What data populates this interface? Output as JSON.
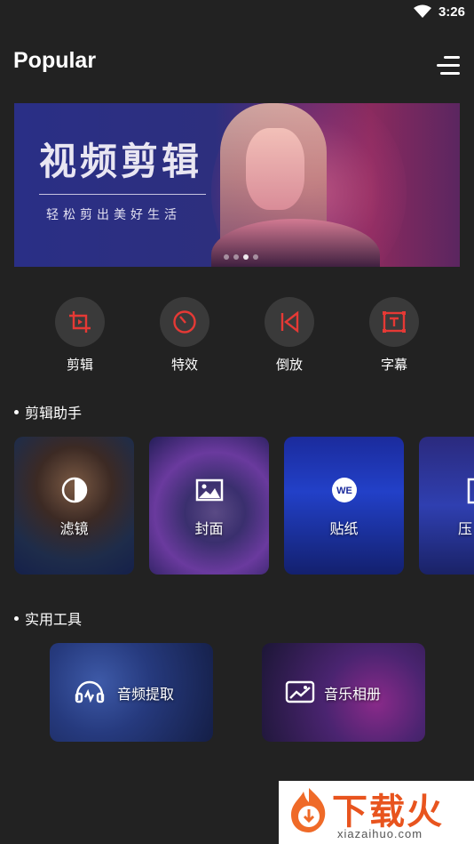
{
  "status_bar": {
    "time": "3:26"
  },
  "header": {
    "title": "Popular"
  },
  "banner": {
    "title": "视频剪辑",
    "subtitle": "轻松剪出美好生活",
    "slide_count": 4,
    "active_slide": 2
  },
  "quick_tools": [
    {
      "label": "剪辑",
      "icon": "crop-icon"
    },
    {
      "label": "特效",
      "icon": "dial-icon"
    },
    {
      "label": "倒放",
      "icon": "reverse-icon"
    },
    {
      "label": "字幕",
      "icon": "text-icon"
    }
  ],
  "assistant": {
    "title": "剪辑助手",
    "cards": [
      {
        "label": "滤镜",
        "icon": "filter-icon"
      },
      {
        "label": "封面",
        "icon": "image-icon"
      },
      {
        "label": "贴纸",
        "icon": "sticker-icon"
      },
      {
        "label": "压",
        "icon": "compress-icon"
      }
    ]
  },
  "utilities": {
    "title": "实用工具",
    "cards": [
      {
        "label": "音频提取",
        "icon": "headphones-icon"
      },
      {
        "label": "音乐相册",
        "icon": "album-icon"
      }
    ]
  },
  "watermark": {
    "brand": "下载火",
    "url": "xiazaihuo.com"
  },
  "colors": {
    "background": "#222222",
    "accent": "#e53935",
    "tool_circle": "#3a3a3a"
  }
}
